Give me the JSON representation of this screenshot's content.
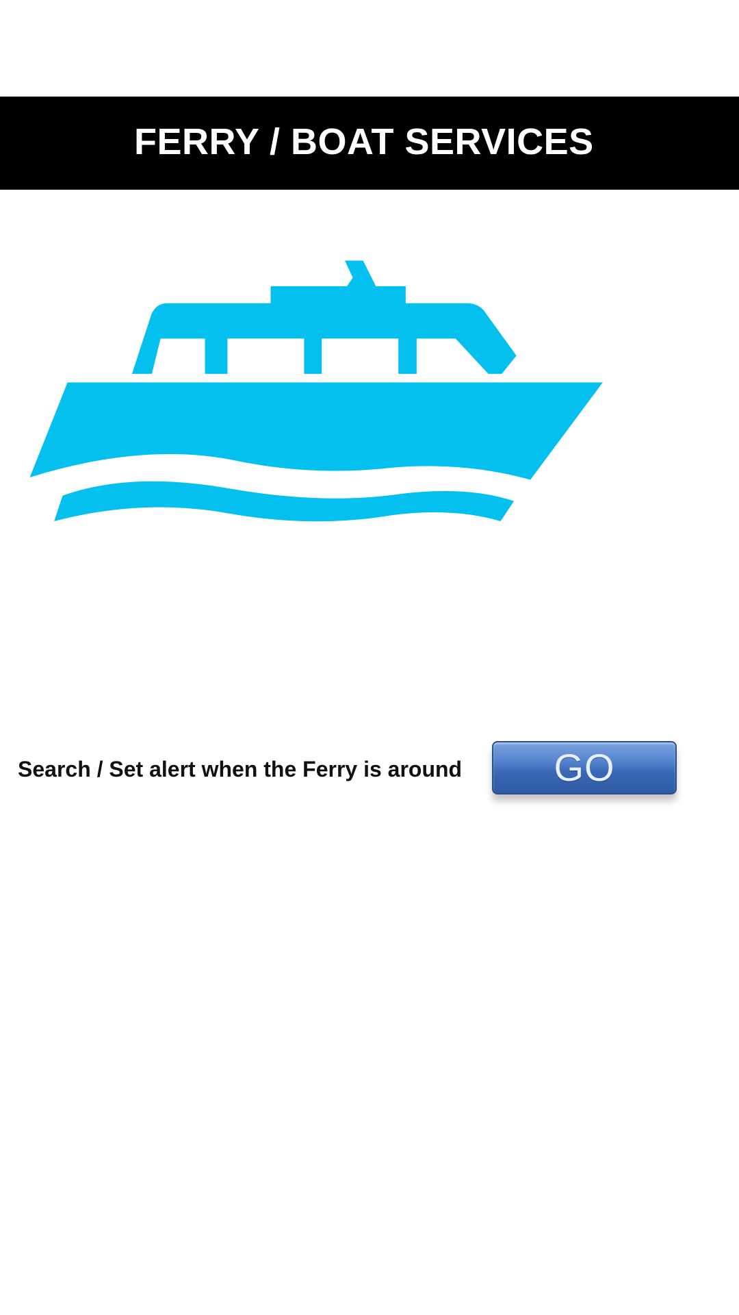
{
  "header": {
    "title": "FERRY / BOAT SERVICES",
    "background": "#000000",
    "text_color": "#ffffff"
  },
  "illustration": {
    "icon": "ferry-boat-icon",
    "color": "#04c0ee"
  },
  "search": {
    "label": "Search / Set alert when the Ferry is around",
    "button_label": "GO",
    "button_color": "#3a68b5"
  }
}
